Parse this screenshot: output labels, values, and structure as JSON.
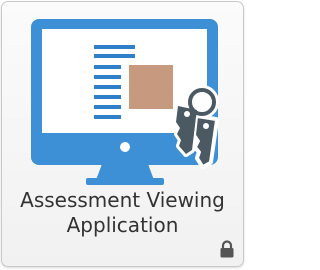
{
  "tile": {
    "title_line1": "Assessment Viewing",
    "title_line2": "Application",
    "icon": "monitor-with-keys-icon",
    "status_icon": "lock-icon"
  },
  "colors": {
    "monitor": "#3d90d6",
    "screen": "#ffffff",
    "text_lines": "#2f80c8",
    "image_box": "#c79a80",
    "keys": "#4b5963",
    "lock": "#555555"
  }
}
